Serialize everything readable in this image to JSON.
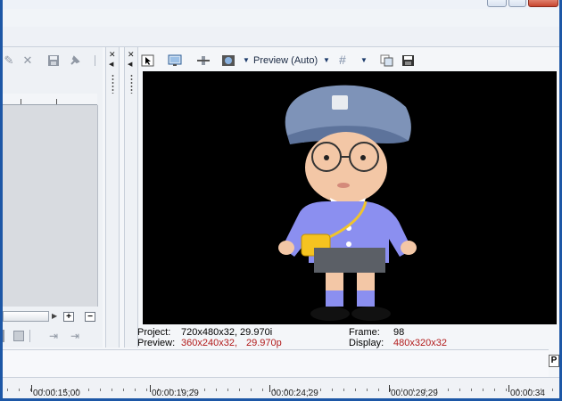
{
  "preview": {
    "mode_label": "Preview (Auto)"
  },
  "info": {
    "project_label": "Project:",
    "project_value": "720x480x32, 29.970i",
    "preview_label": "Preview:",
    "preview_size": "360x240x32,",
    "preview_rate": "29.970p",
    "frame_label": "Frame:",
    "frame_value": "98",
    "display_label": "Display:",
    "display_value": "480x320x32"
  },
  "timeline": {
    "ticks": [
      "00:00:15;00",
      "00:00:19;29",
      "00:00:24;29",
      "00:00:29;29",
      "00:00:34"
    ]
  },
  "scroll": {
    "zoom_in": "+",
    "zoom_out": "−"
  },
  "side_badge": "P",
  "icons": {
    "pin": "pin-icon",
    "close": "close-icon",
    "save": "save-icon",
    "tack": "tack-icon"
  },
  "colors": {
    "frame_blue": "#1d57a6",
    "info_red": "#b21b1b"
  }
}
